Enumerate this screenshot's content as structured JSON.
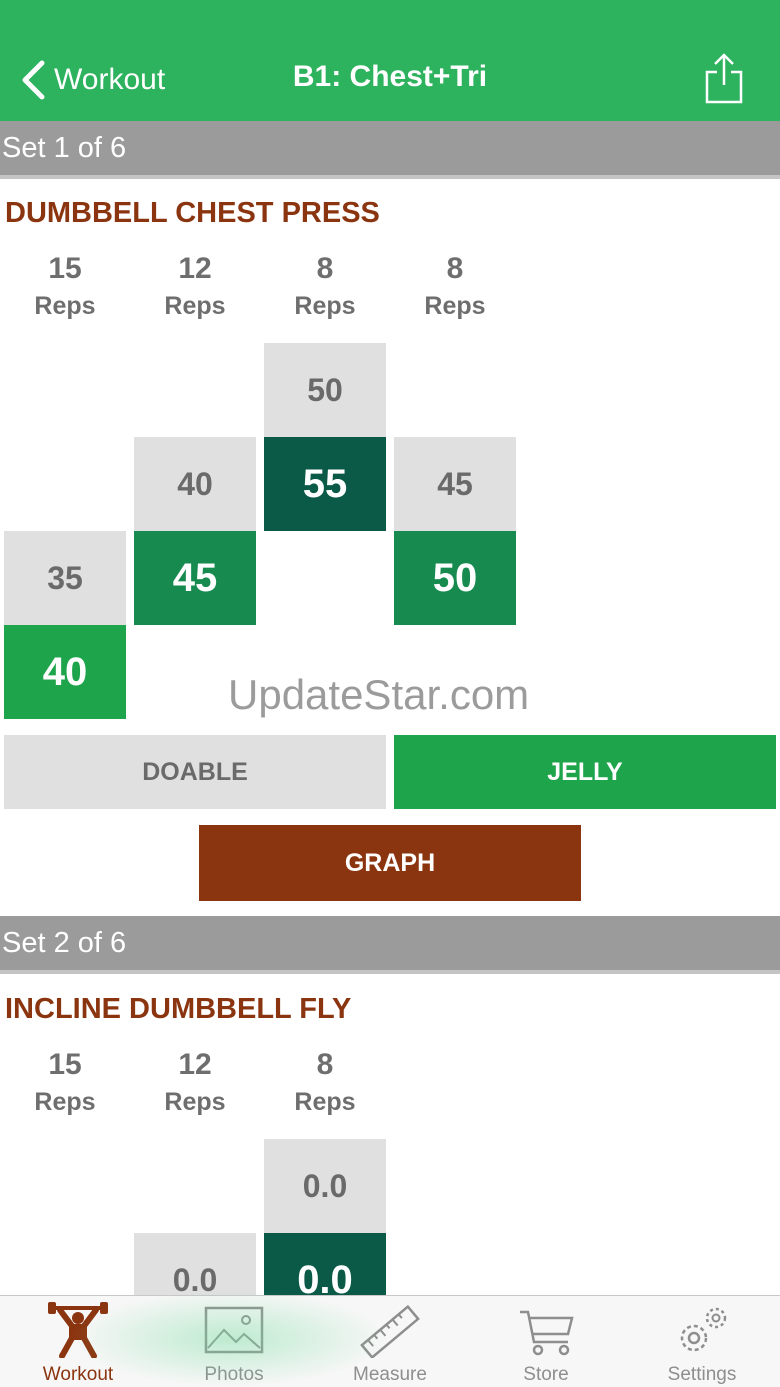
{
  "nav": {
    "back_label": "Workout",
    "title": "B1: Chest+Tri"
  },
  "sets": [
    {
      "header": "Set 1 of 6",
      "exercise": "DUMBBELL CHEST PRESS",
      "columns": [
        {
          "reps": "15",
          "reps_label": "Reps",
          "prev": "35",
          "current": "40",
          "current_color": "#1ea54c"
        },
        {
          "reps": "12",
          "reps_label": "Reps",
          "prev": "40",
          "current": "45",
          "current_color": "#168a4f"
        },
        {
          "reps": "8",
          "reps_label": "Reps",
          "prev": "50",
          "current": "55",
          "current_color": "#0b5a48"
        },
        {
          "reps": "8",
          "reps_label": "Reps",
          "prev": "45",
          "current": "50",
          "current_color": "#168a4f"
        }
      ],
      "buttons": {
        "doable": "DOABLE",
        "jelly": "JELLY",
        "graph": "GRAPH"
      }
    },
    {
      "header": "Set 2 of 6",
      "exercise": "INCLINE DUMBBELL FLY",
      "columns": [
        {
          "reps": "15",
          "reps_label": "Reps"
        },
        {
          "reps": "12",
          "reps_label": "Reps",
          "prev": "0.0"
        },
        {
          "reps": "8",
          "reps_label": "Reps",
          "prev": "0.0",
          "current": "0.0",
          "current_color": "#0b5a48"
        }
      ]
    }
  ],
  "watermark": "UpdateStar.com",
  "tabs": [
    {
      "label": "Workout",
      "icon": "weightlifter-icon",
      "active": true
    },
    {
      "label": "Photos",
      "icon": "photo-icon",
      "active": false
    },
    {
      "label": "Measure",
      "icon": "ruler-icon",
      "active": false
    },
    {
      "label": "Store",
      "icon": "cart-icon",
      "active": false
    },
    {
      "label": "Settings",
      "icon": "gears-icon",
      "active": false
    }
  ],
  "colors": {
    "nav_green": "#2db25e",
    "accent_brown": "#8b3510",
    "jelly_green": "#1ea54c"
  }
}
